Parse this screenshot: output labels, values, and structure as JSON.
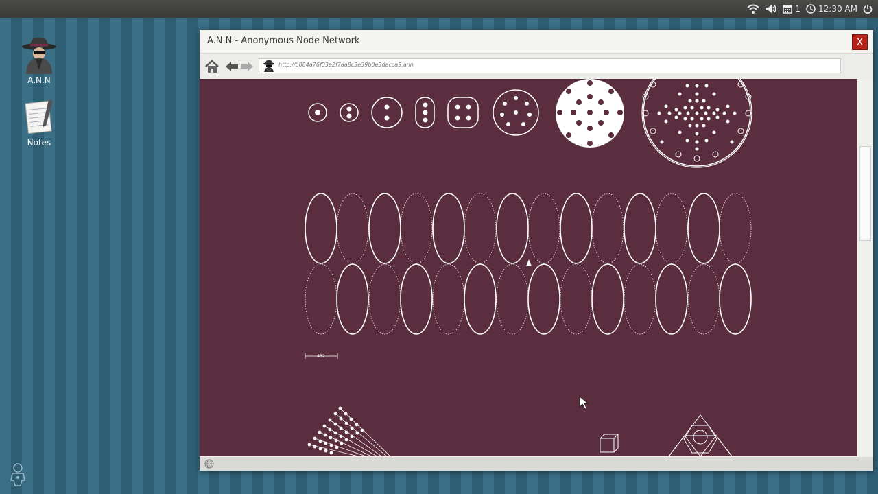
{
  "system": {
    "notification_count": "1",
    "clock": "12:30 AM"
  },
  "desktop": {
    "icons": [
      {
        "label": "A.N.N",
        "icon": "spy-hat-icon"
      },
      {
        "label": "Notes",
        "icon": "notepad-icon"
      }
    ]
  },
  "window": {
    "title": "A.N.N - Anonymous Node Network",
    "close_label": "X",
    "url": "http://b084a76f03e2f7aa8c3e39b0e3dacca9.ann"
  },
  "content": {
    "scale_label": "432"
  },
  "colors": {
    "page_background": "#5a2e3f",
    "close_button": "#b8241c"
  }
}
